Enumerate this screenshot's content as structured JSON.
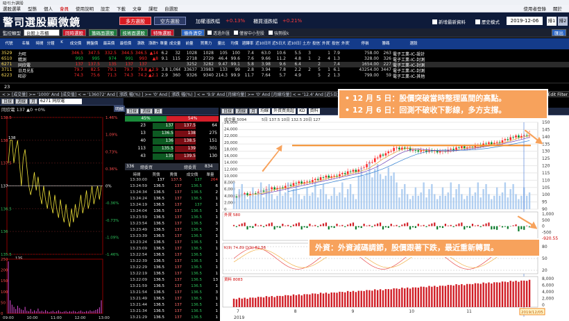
{
  "titlebar": {
    "title": "吸引力選股"
  },
  "menubar": {
    "items": [
      "選股選單",
      "型態",
      "個人",
      "會員",
      "使用說明",
      "設定",
      "下載",
      "文章",
      "課程",
      "自選股"
    ],
    "right_items": [
      "使用者登錄",
      "關於"
    ]
  },
  "banner": {
    "logo": "警司選股顯微鏡",
    "btn_long": "多方選股",
    "btn_short": "空方選股",
    "stat1_label": "加權漲跌幅",
    "stat1_value": "+0.13%",
    "stat2_label": "櫃買漲跌幅",
    "stat2_value": "+0.21%",
    "chk1": "新增最新資料",
    "chk2": "歷史模式",
    "date": "2019-12-06",
    "tab1": "排1",
    "tab2": "排2"
  },
  "toolbar": {
    "label": "監控類型",
    "select": "台股上市櫃",
    "btns": [
      "同時選股",
      "籌碼面選股",
      "技術面選股",
      "特殊選股"
    ],
    "clear": "條件清空",
    "chk1": "透過外匯",
    "chk2": "僅留中小型股",
    "chk3": "強勢股k",
    "right": "匯出"
  },
  "table": {
    "headers": [
      "代號",
      "名稱",
      "時間",
      "分鐘",
      "K",
      "成交價",
      "開盤價",
      "最高價",
      "最低價",
      "漲跌",
      "漲跌%",
      "單量",
      "成交量",
      "前量",
      "買賣力",
      "量比",
      "均價",
      "週轉率",
      "近10日均量",
      "近5日大戶",
      "近10日漲幅",
      "土方信",
      "投信買",
      "外資買",
      "投信賣",
      "外資賣",
      "停損",
      "籌碼",
      "選股",
      "股本(百萬)",
      "市值",
      "產業別"
    ],
    "rows": [
      [
        "3529",
        "力旺",
        "",
        "",
        "",
        "346.5",
        "347.5",
        "332.5",
        "344.5",
        "346.5",
        "▲14",
        "6.2",
        "32",
        "1028",
        "1028",
        "105",
        "100",
        "7.4",
        "63.0",
        "10.6",
        "5.5",
        "3",
        "",
        "1",
        "7.9",
        "",
        "758.00",
        "263",
        "電子工業-IC-設計"
      ],
      [
        "6510",
        "精測",
        "",
        "",
        "",
        "993",
        "995",
        "974",
        "991",
        "993",
        "▲8",
        "9.1",
        "115",
        "2718",
        "2729",
        "46.4",
        "99.6",
        "7.6",
        "9.66",
        "11.2",
        "4.8",
        "1",
        "2",
        "4",
        "1.3",
        "",
        "328.00",
        "326",
        "電子工業-IC-封測"
      ],
      [
        "6271",
        "同欣電",
        "",
        "",
        "",
        "137",
        "137.5",
        "135",
        "137",
        "137",
        "",
        "",
        "",
        "3252",
        "3282",
        "9.47",
        "99.1",
        "5.8",
        "3.98",
        "9.6",
        "6.4",
        "",
        "2",
        "",
        "7.4",
        "",
        "1654.00",
        "227",
        "電子工業-IC-封測"
      ],
      [
        "3711",
        "日月光投控",
        "",
        "",
        "",
        "79.7",
        "82.5",
        "79.1",
        "79.7",
        "79.8",
        "▲2.9",
        "3.8",
        "1,066",
        "33637",
        "33983",
        "133",
        "99",
        "2.8",
        "3.94",
        "7.8",
        "2.2",
        "2",
        "5",
        "1",
        "6.1",
        "",
        "43254.00",
        "3447",
        "電子工業-IC-封測"
      ],
      [
        "6223",
        "旺矽",
        "",
        "",
        "",
        "74.3",
        "75.6",
        "71.3",
        "74.3",
        "74.2",
        "▲2.1",
        "2.9",
        "360",
        "9326",
        "9340",
        "214.3",
        "99.9",
        "11.7",
        "7.64",
        "5.7",
        "4.9",
        "",
        "5",
        "2",
        "1.3",
        "",
        "799.00",
        "59",
        "電子工業-IC-其他"
      ]
    ],
    "count": "23"
  },
  "filter": {
    "text": "< > [成交量] >= '1000' And [成交值] < = '136072' And [ 漲跌  幅(%) ] >= '0' And [ 漲跌  幅(%) ] < = '9.9' And [月線均量] >= '0' And [月線均量] < = '12.4' And [近5日量總集中率] >= '0' And [近5日量集中率] < = '...",
    "right": "Edit Filter"
  },
  "intraday": {
    "tabs": [
      "日線",
      "週線",
      "月"
    ],
    "code": "6271 同欣電",
    "info": "同欣電 137 ▲0 +0%",
    "btn": "明細",
    "price_ticks": [
      "138.5",
      "138",
      "137.5",
      "137",
      "136.5",
      "136",
      "135.5"
    ],
    "pct_ticks": [
      "1.46%",
      "1.09%",
      "0.73%",
      "0.36%",
      "0%",
      "-0.36%",
      "-0.73%",
      "-1.09%",
      "-1.46%"
    ],
    "vol_ticks": [
      "250",
      "200",
      "150",
      "100",
      "50",
      "0"
    ],
    "time_ticks": [
      "09:00",
      "10:00",
      "11:00",
      "12:00",
      "13:00"
    ],
    "price_high": "138",
    "price_low": "135"
  },
  "orderbook": {
    "tabs": [
      "日線",
      "週線",
      "月"
    ],
    "buy_pct": "45%",
    "sell_pct": "54%",
    "rows": [
      [
        "23",
        "137",
        "137.5",
        "64"
      ],
      [
        "13",
        "136.5",
        "138",
        "275"
      ],
      [
        "40",
        "136",
        "138.5",
        "151"
      ],
      [
        "113",
        "135.5",
        "139",
        "301"
      ],
      [
        "43",
        "135",
        "139.5",
        "130"
      ]
    ],
    "footer_left": "336",
    "footer_mid": "總委買",
    "footer_mid2": "總委賣",
    "footer_right": "834",
    "trade_head": [
      "時間",
      "買價",
      "賣價",
      "成交價",
      "單量"
    ],
    "trades": [
      [
        "13:30:00",
        "137",
        "137.5",
        "137",
        "264"
      ],
      [
        "13:24:59",
        "136.5",
        "137",
        "136.5",
        "6"
      ],
      [
        "13:24:34",
        "136.5",
        "137",
        "136.5",
        "2"
      ],
      [
        "13:24:24",
        "136.5",
        "137",
        "136.5",
        "1"
      ],
      [
        "13:24:19",
        "136.5",
        "137",
        "137",
        "1"
      ],
      [
        "13:24:04",
        "136.5",
        "137",
        "136.5",
        "1"
      ],
      [
        "13:23:59",
        "136.5",
        "137",
        "136.5",
        "1"
      ],
      [
        "13:23:54",
        "136.5",
        "137",
        "136.5",
        "3"
      ],
      [
        "13:23:49",
        "136.5",
        "137",
        "136.5",
        "3"
      ],
      [
        "13:23:39",
        "136.5",
        "137",
        "136.5",
        "1"
      ],
      [
        "13:23:24",
        "136.5",
        "137",
        "136.5",
        "1"
      ],
      [
        "13:23:09",
        "136.5",
        "137",
        "136.5",
        "1"
      ],
      [
        "13:22:54",
        "136.5",
        "137",
        "136.5",
        "1"
      ],
      [
        "13:22:39",
        "136.5",
        "137",
        "136.5",
        "1"
      ],
      [
        "13:22:29",
        "136.5",
        "137",
        "136.5",
        "1"
      ],
      [
        "13:22:19",
        "136.5",
        "137",
        "136.5",
        "1"
      ],
      [
        "13:22:09",
        "136.5",
        "137",
        "136.5",
        "13"
      ],
      [
        "13:21:59",
        "136.5",
        "137",
        "136.5",
        "1"
      ],
      [
        "13:21:54",
        "136.5",
        "137",
        "136.5",
        "3"
      ],
      [
        "13:21:49",
        "136.5",
        "137",
        "136.5",
        "1"
      ],
      [
        "13:21:44",
        "136.5",
        "137",
        "136.5",
        "1"
      ],
      [
        "13:21:34",
        "136.5",
        "137",
        "136.5",
        "1"
      ],
      [
        "13:21:29",
        "136.5",
        "137",
        "136.5",
        "1"
      ]
    ]
  },
  "kchart": {
    "tabs": [
      "日線",
      "週線",
      "月"
    ],
    "sel1": "均線",
    "sel2": "外資買賣超",
    "sel3": "KD",
    "sel4": "資料",
    "vol_label": "成交量 5094",
    "ma_label": "5日 137.5  10日 132.5  20日 127",
    "price_ticks": [
      "150",
      "145",
      "140",
      "135",
      "130",
      "125",
      "120",
      "115",
      "110",
      "105",
      "100",
      "95",
      "90"
    ],
    "vol_ticks": [
      "26,000",
      "24,000",
      "22,000",
      "20,000",
      "18,000",
      "16,000",
      "14,000",
      "12,000",
      "10,000",
      "8,000",
      "6,000",
      "4,000",
      "2,000",
      "0"
    ],
    "foreign_label": "外資 580",
    "foreign_ticks": [
      "1,000",
      "500",
      "0",
      "-500",
      "-920.55"
    ],
    "kd_label": "K(9) 74.89  D(9) 62.56",
    "kd_ticks": [
      "80",
      "50",
      "20"
    ],
    "margin_label": "資料 8083",
    "margin_ticks": [
      "8,000",
      "6,000",
      "4,000",
      "2,000",
      "0"
    ],
    "months": [
      "7",
      "8",
      "9",
      "10",
      "11"
    ],
    "year": "2019",
    "date_tag": "2019/12/05"
  },
  "annotations": {
    "a1_line1": "12 月 5 日：股價突破當時整理區間的高點。",
    "a1_line2": "12 月 6 日：回測不破收下影線，多方支撐。",
    "a2": "外資：外資減碼調節，股價跟著下跌，最近重新轉買。"
  },
  "colors": {
    "up": "#ff2a2a",
    "down": "#19c34b",
    "annotation": "#f7a25c",
    "navy": "#0e1b3a",
    "header_blue": "#143b8a"
  }
}
